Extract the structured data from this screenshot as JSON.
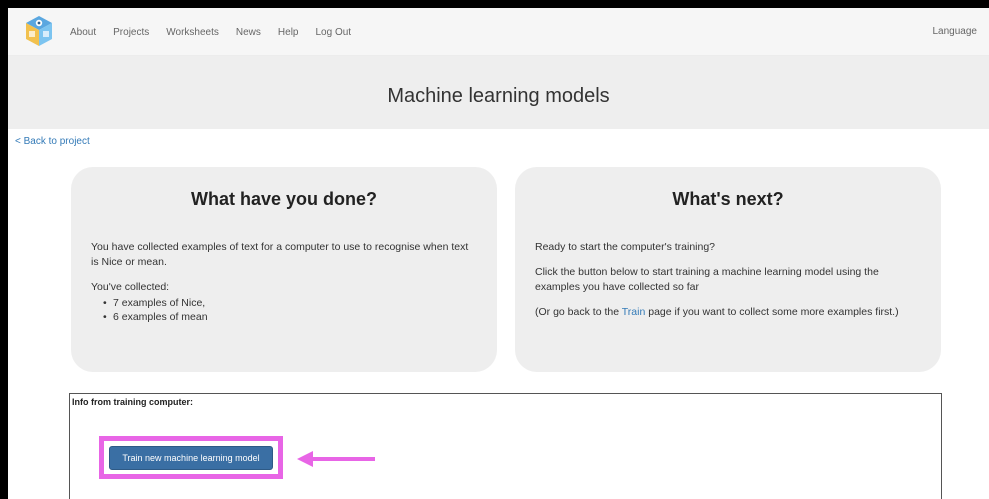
{
  "nav": {
    "links": [
      "About",
      "Projects",
      "Worksheets",
      "News",
      "Help",
      "Log Out"
    ],
    "language": "Language"
  },
  "page": {
    "title": "Machine learning models",
    "back_link": "< Back to project"
  },
  "left_card": {
    "title": "What have you done?",
    "description": "You have collected examples of text for a computer to use to recognise when text is Nice or mean.",
    "collected_label": "You've collected:",
    "items": [
      "7 examples of Nice,",
      "6 examples of mean"
    ]
  },
  "right_card": {
    "title": "What's next?",
    "line1": "Ready to start the computer's training?",
    "line2": "Click the button below to start training a machine learning model using the examples you have collected so far",
    "line3_before": "(Or go back to the ",
    "line3_link": "Train",
    "line3_after": " page if you want to collect some more examples first.)"
  },
  "training": {
    "label": "Info from training computer:",
    "button": "Train new machine learning model"
  },
  "colors": {
    "accent": "#337ab7",
    "highlight": "#e865e6",
    "button": "#3a6fa4"
  }
}
